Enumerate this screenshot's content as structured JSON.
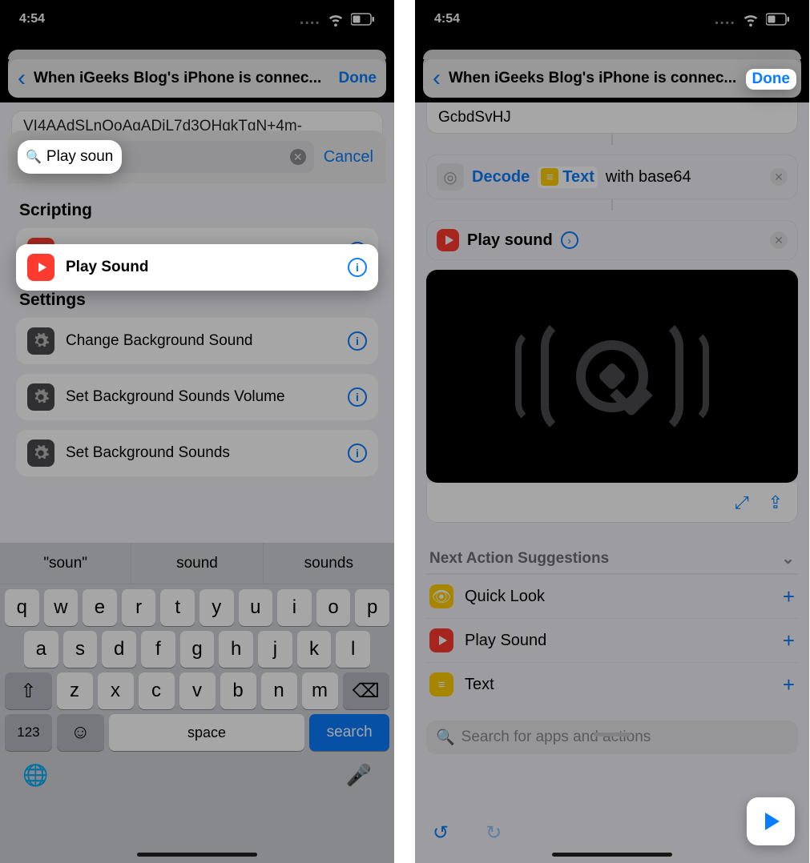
{
  "status": {
    "time": "4:54"
  },
  "left": {
    "title": "When iGeeks Blog's iPhone is connec...",
    "done": "Done",
    "peek_text": "VI4AAdSLnQoAgADjL7d3OHqkTgN+4m-",
    "search_value": "Play soun",
    "cancel": "Cancel",
    "sections": {
      "scripting": {
        "title": "Scripting",
        "items": [
          {
            "label": "Play Sound",
            "icon": "play-red"
          }
        ]
      },
      "settings": {
        "title": "Settings",
        "items": [
          {
            "label": "Change Background Sound",
            "icon": "gear"
          },
          {
            "label": "Set Background Sounds Volume",
            "icon": "gear"
          },
          {
            "label": "Set Background Sounds",
            "icon": "gear"
          }
        ]
      }
    },
    "keyboard": {
      "suggest": [
        "\"soun\"",
        "sound",
        "sounds"
      ],
      "row1": [
        "q",
        "w",
        "e",
        "r",
        "t",
        "y",
        "u",
        "i",
        "o",
        "p"
      ],
      "row2": [
        "a",
        "s",
        "d",
        "f",
        "g",
        "h",
        "j",
        "k",
        "l"
      ],
      "row3": [
        "⇧",
        "z",
        "x",
        "c",
        "v",
        "b",
        "n",
        "m",
        "⌫"
      ],
      "fn": {
        "num": "123",
        "emoji": "☺",
        "space": "space",
        "search": "search"
      }
    }
  },
  "right": {
    "title": "When iGeeks Blog's iPhone is connec...",
    "done": "Done",
    "text_block": "GcbdSvHJ",
    "decode": {
      "action": "Decode",
      "param_label": "Text",
      "with": "with base64"
    },
    "play": {
      "label": "Play sound"
    },
    "suggestions": {
      "title": "Next Action Suggestions",
      "items": [
        {
          "label": "Quick Look",
          "icon": "eye"
        },
        {
          "label": "Play Sound",
          "icon": "play-red"
        },
        {
          "label": "Text",
          "icon": "text"
        }
      ]
    },
    "search_placeholder": "Search for apps and actions"
  }
}
